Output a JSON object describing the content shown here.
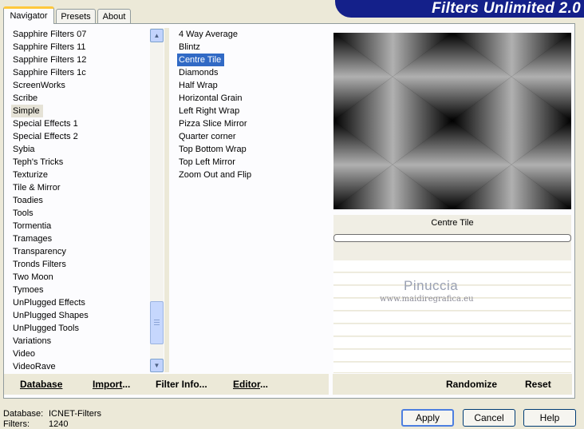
{
  "banner": {
    "title": "Filters Unlimited 2.0"
  },
  "tabs": [
    {
      "label": "Navigator"
    },
    {
      "label": "Presets"
    },
    {
      "label": "About"
    }
  ],
  "categories": [
    "Sapphire Filters 07",
    "Sapphire Filters 11",
    "Sapphire Filters 12",
    "Sapphire Filters 1c",
    "ScreenWorks",
    "Scribe",
    "Simple",
    "Special Effects 1",
    "Special Effects 2",
    "Sybia",
    "Teph's Tricks",
    "Texturize",
    "Tile & Mirror",
    "Toadies",
    "Tools",
    "Tormentia",
    "Tramages",
    "Transparency",
    "Tronds Filters",
    "Two Moon",
    "Tymoes",
    "UnPlugged Effects",
    "UnPlugged Shapes",
    "UnPlugged Tools",
    "Variations",
    "Video",
    "VideoRave"
  ],
  "selected_category": "Simple",
  "filters": [
    "4 Way Average",
    "Blintz",
    "Centre Tile",
    "Diamonds",
    "Half Wrap",
    "Horizontal Grain",
    "Left Right Wrap",
    "Pizza Slice Mirror",
    "Quarter corner",
    "Top Bottom Wrap",
    "Top Left Mirror",
    "Zoom Out and Flip"
  ],
  "selected_filter": "Centre Tile",
  "preview": {
    "filter_title": "Centre Tile"
  },
  "watermark": {
    "name": "Pinuccia",
    "site": "www.maidiregrafica.eu"
  },
  "left_buttons": {
    "database": "Database",
    "import": "Import...",
    "filter_info": "Filter Info...",
    "editor": "Editor..."
  },
  "right_buttons": {
    "randomize": "Randomize",
    "reset": "Reset"
  },
  "status": {
    "database_label": "Database:",
    "database_value": "ICNET-Filters",
    "filters_label": "Filters:",
    "filters_value": "1240"
  },
  "dialog_buttons": {
    "apply": "Apply",
    "cancel": "Cancel",
    "help": "Help"
  },
  "colors": {
    "selection": "#316ac5",
    "banner": "#14208a",
    "tab_accent": "#ffc83c"
  }
}
